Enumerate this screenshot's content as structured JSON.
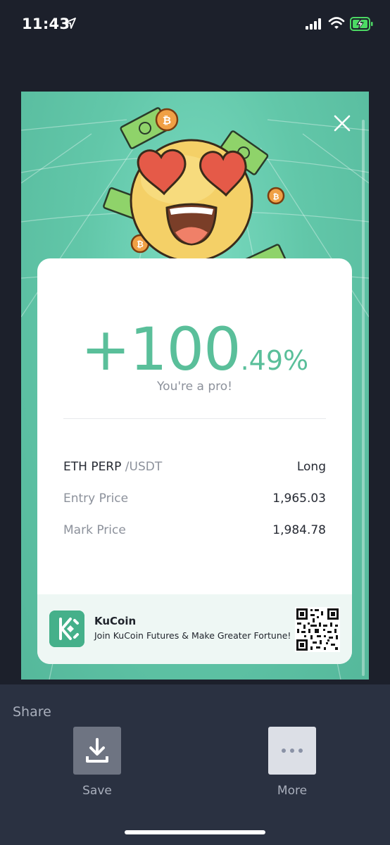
{
  "status_bar": {
    "time": "11:43"
  },
  "card": {
    "pnl_integer": "+100",
    "pnl_decimal": ".49%",
    "subtitle": "You're a pro!",
    "pair_base": "ETH PERP",
    "pair_quote": "/USDT",
    "direction": "Long",
    "rows": [
      {
        "label": "Entry Price",
        "value": "1,965.03"
      },
      {
        "label": "Mark Price",
        "value": "1,984.78"
      }
    ],
    "footer": {
      "brand": "KuCoin",
      "slogan": "Join KuCoin Futures & Make Greater Fortune!"
    }
  },
  "share_sheet": {
    "title": "Share",
    "save_label": "Save",
    "more_label": "More"
  },
  "colors": {
    "accent_green": "#5abf9a",
    "card_bg": "#62c7a9",
    "sheet_bg": "#2a3141"
  },
  "icons": [
    "location-arrow-icon",
    "signal-icon",
    "wifi-icon",
    "battery-charging-icon",
    "close-icon",
    "download-icon",
    "more-dots-icon",
    "kucoin-logo-icon",
    "qr-code"
  ]
}
